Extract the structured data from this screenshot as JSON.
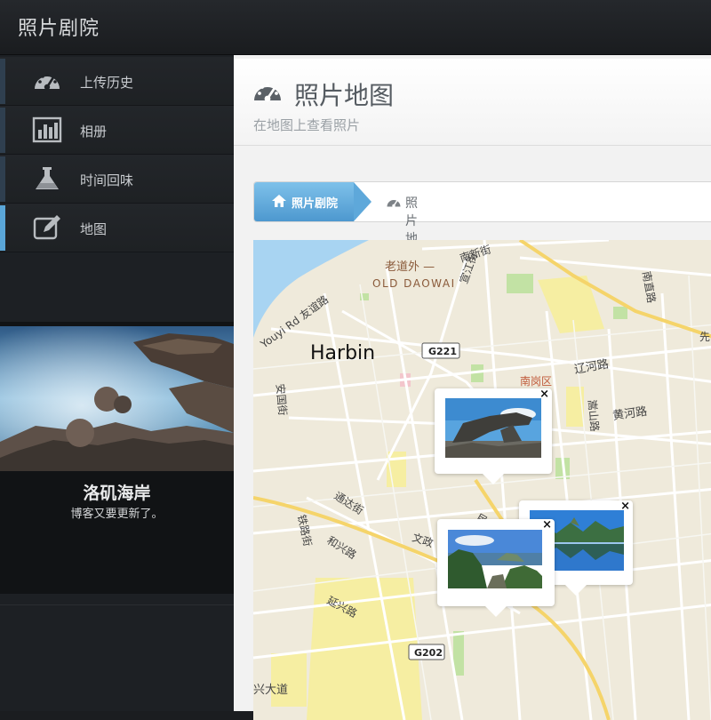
{
  "app": {
    "title": "照片剧院"
  },
  "sidebar": {
    "items": [
      {
        "label": "上传历史",
        "icon": "dashboard-icon",
        "active": false
      },
      {
        "label": "相册",
        "icon": "bar-chart-icon",
        "active": false
      },
      {
        "label": "时间回味",
        "icon": "flask-icon",
        "active": false
      },
      {
        "label": "地图",
        "icon": "edit-icon",
        "active": true
      }
    ],
    "feature": {
      "title": "洛矶海岸",
      "subtitle": "博客又要更新了。"
    }
  },
  "page": {
    "title": "照片地图",
    "subtitle": "在地图上查看照片",
    "breadcrumb": {
      "home": "照片剧院",
      "current": "照片地图"
    }
  },
  "map": {
    "labels": {
      "city": "Harbin",
      "old_daowai_cn": "老道外 —",
      "old_daowai_en": "OLD DAOWAI",
      "nanxin": "南新街",
      "youyi": "Youyi Rd 友谊路",
      "g221": "G221",
      "nangang": "南岗区",
      "liaohe": "辽河路",
      "huanghe": "黄河路",
      "anguo": "安国街",
      "tongda": "通达街",
      "hexing": "和兴路",
      "wenzheng": "文政",
      "min": "民",
      "yanxing": "延兴路",
      "g202": "G202",
      "xingda": "兴大道",
      "nanzhi": "南直路",
      "xian": "先",
      "tielu": "铁路街",
      "songshan": "嵩山路",
      "jiangjiang": "宣江街"
    },
    "popups": [
      {
        "photo": "rock-arch-photo",
        "close": "×"
      },
      {
        "photo": "lake-photo",
        "close": "×"
      },
      {
        "photo": "coast-photo",
        "close": "×"
      }
    ]
  },
  "colors": {
    "accent": "#5aa6d8",
    "sidebar_bg": "#1d2024",
    "water": "#a8d4f2",
    "road_major": "#f5d46a"
  }
}
